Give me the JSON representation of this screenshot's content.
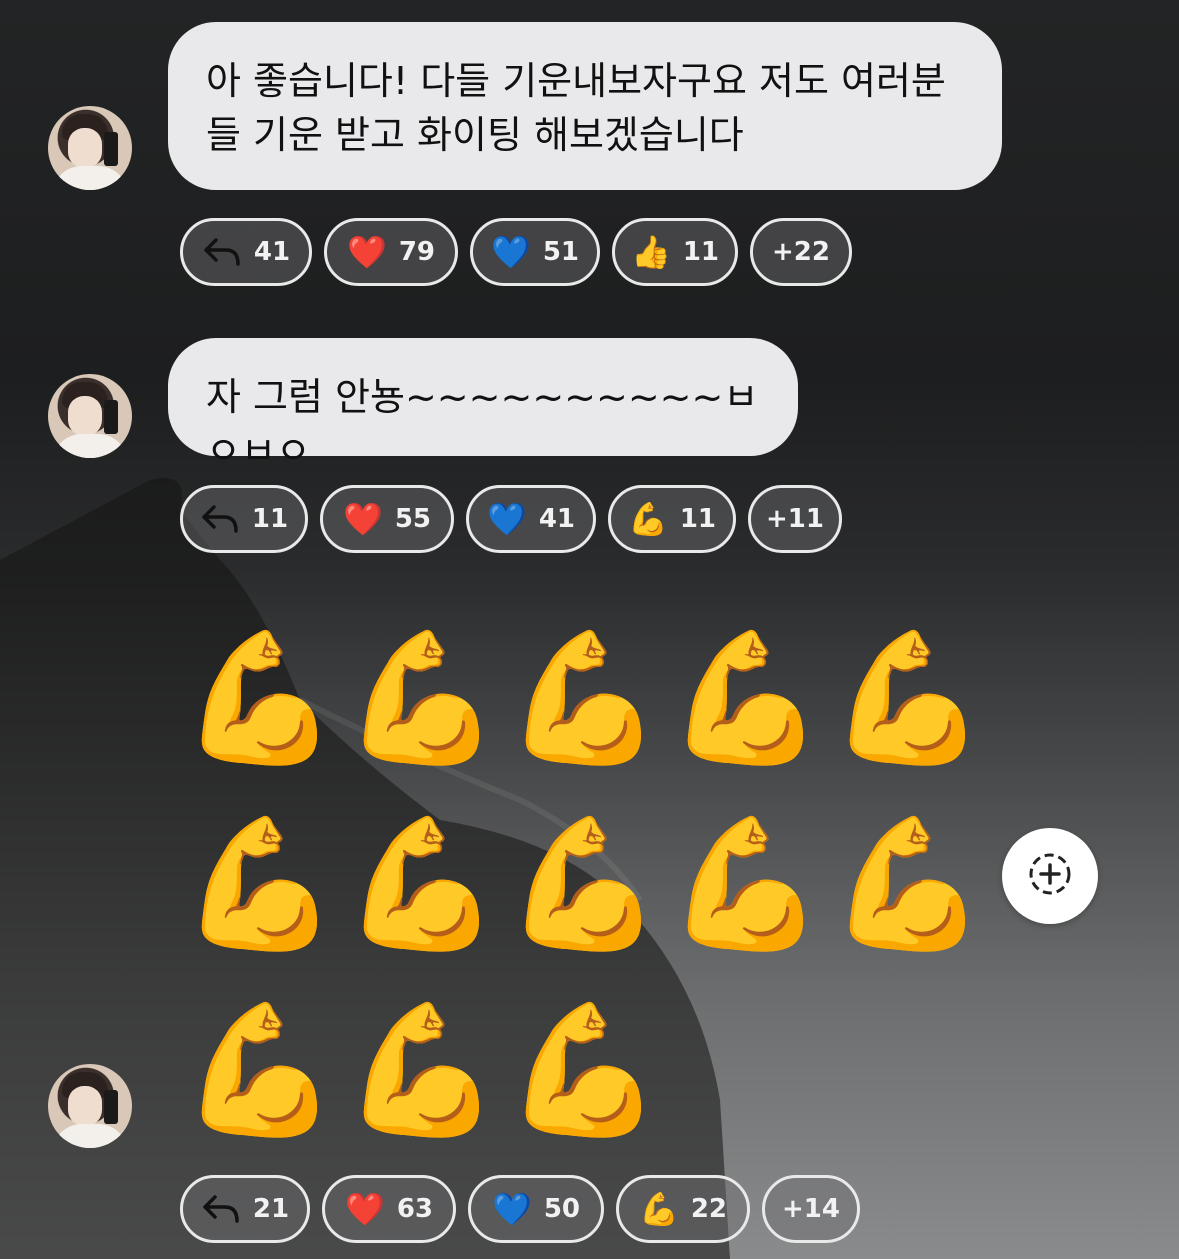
{
  "messages": [
    {
      "text": "아 좋습니다! 다들 기운내보자구요 저도 여러분들 기운 받고 화이팅 해보겠습니다",
      "reply_count": "41",
      "reactions": [
        {
          "emoji": "❤️",
          "count": "79"
        },
        {
          "emoji": "💙",
          "count": "51"
        },
        {
          "emoji": "👍",
          "count": "11"
        }
      ],
      "more": "+22"
    },
    {
      "text": "자 그럼 안뇽~~~~~~~~~~ㅂㅇㅂㅇ",
      "reply_count": "11",
      "reactions": [
        {
          "emoji": "❤️",
          "count": "55"
        },
        {
          "emoji": "💙",
          "count": "41"
        },
        {
          "emoji": "💪",
          "count": "11"
        }
      ],
      "more": "+11"
    },
    {
      "emoji_text": "💪💪💪💪💪💪💪💪💪💪💪💪💪",
      "reply_count": "21",
      "reactions": [
        {
          "emoji": "❤️",
          "count": "63"
        },
        {
          "emoji": "💙",
          "count": "50"
        },
        {
          "emoji": "💪",
          "count": "22"
        }
      ],
      "more": "+14"
    }
  ],
  "icons": {
    "reply": "reply-arrow-icon",
    "add_reaction": "add-reaction-icon"
  }
}
